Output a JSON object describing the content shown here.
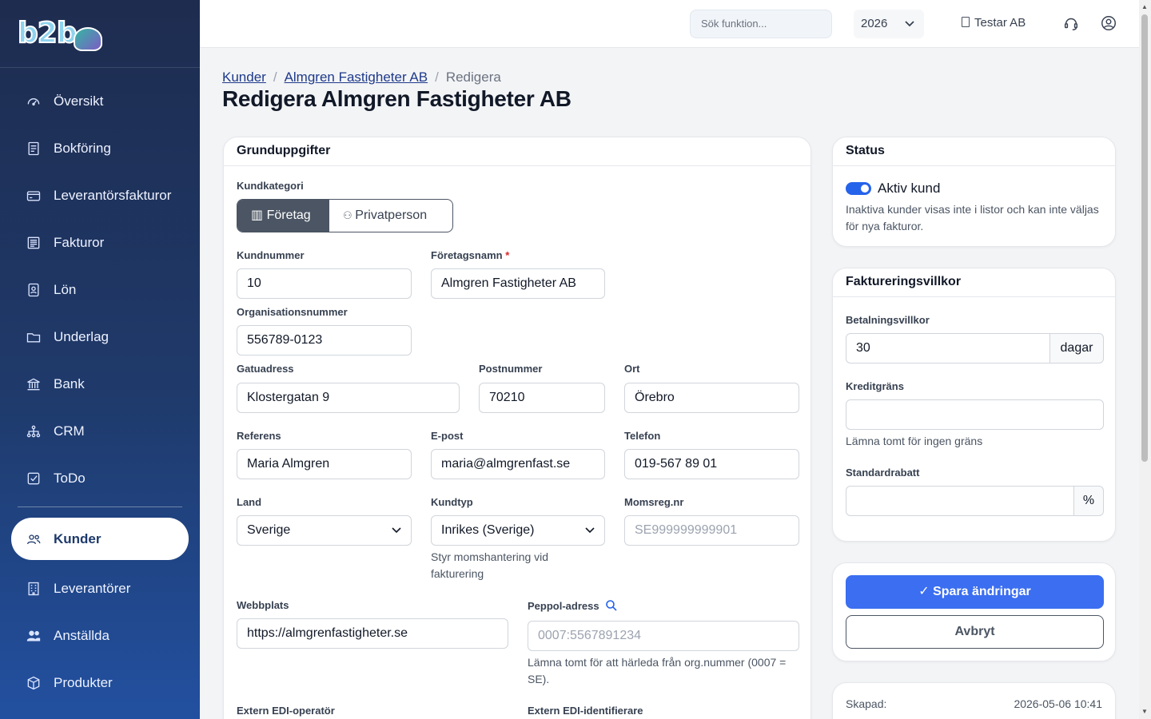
{
  "app": {
    "logo": "b2b"
  },
  "sidebar": {
    "items": [
      {
        "label": "Översikt",
        "icon": "gauge-icon"
      },
      {
        "label": "Bokföring",
        "icon": "ledger-icon"
      },
      {
        "label": "Leverantörsfakturor",
        "icon": "credit-card-icon"
      },
      {
        "label": "Fakturor",
        "icon": "invoice-icon"
      },
      {
        "label": "Lön",
        "icon": "badge-icon"
      },
      {
        "label": "Underlag",
        "icon": "folder-icon"
      },
      {
        "label": "Bank",
        "icon": "bank-icon"
      },
      {
        "label": "CRM",
        "icon": "org-chart-icon"
      },
      {
        "label": "ToDo",
        "icon": "checkbox-icon"
      },
      {
        "label": "Kunder",
        "icon": "users-icon",
        "active": true
      },
      {
        "label": "Leverantörer",
        "icon": "building-icon"
      },
      {
        "label": "Anställda",
        "icon": "people-icon"
      },
      {
        "label": "Produkter",
        "icon": "box-icon"
      }
    ]
  },
  "topbar": {
    "search_placeholder": "Sök funktion...",
    "year": "2026",
    "company": "Testar AB"
  },
  "breadcrumb": {
    "root": "Kunder",
    "customer": "Almgren Fastigheter AB",
    "current": "Redigera"
  },
  "page_title": "Redigera Almgren Fastigheter AB",
  "basics": {
    "title": "Grunduppgifter",
    "category_label": "Kundkategori",
    "category_company": "Företag",
    "category_private": "Privatperson",
    "customer_number_label": "Kundnummer",
    "customer_number": "10",
    "company_name_label": "Företagsnamn",
    "company_name": "Almgren Fastigheter AB",
    "org_number_label": "Organisationsnummer",
    "org_number": "556789-0123",
    "street_label": "Gatuadress",
    "street": "Klostergatan 9",
    "postal_label": "Postnummer",
    "postal": "70210",
    "city_label": "Ort",
    "city": "Örebro",
    "reference_label": "Referens",
    "reference": "Maria Almgren",
    "email_label": "E-post",
    "email": "maria@almgrenfast.se",
    "phone_label": "Telefon",
    "phone": "019-567 89 01",
    "country_label": "Land",
    "country": "Sverige",
    "customer_type_label": "Kundtyp",
    "customer_type": "Inrikes (Sverige)",
    "customer_type_hint": "Styr momshantering vid fakturering",
    "vat_label": "Momsreg.nr",
    "vat_placeholder": "SE999999999901",
    "website_label": "Webbplats",
    "website": "https://almgrenfastigheter.se",
    "peppol_label": "Peppol-adress",
    "peppol_placeholder": "0007:5567891234",
    "peppol_hint": "Lämna tomt för att härleda från org.nummer (0007 = SE).",
    "edi_operator_label": "Extern EDI-operatör",
    "edi_id_label": "Extern EDI-identifierare"
  },
  "status": {
    "title": "Status",
    "active_label": "Aktiv kund",
    "active": true,
    "hint": "Inaktiva kunder visas inte i listor och kan inte väljas för nya fakturor."
  },
  "billing": {
    "title": "Faktureringsvillkor",
    "payment_terms_label": "Betalningsvillkor",
    "payment_terms": "30",
    "payment_terms_unit": "dagar",
    "credit_limit_label": "Kreditgräns",
    "credit_limit_hint": "Lämna tomt för ingen gräns",
    "discount_label": "Standardrabatt",
    "discount_unit": "%"
  },
  "actions": {
    "save": "✓ Spara ändringar",
    "cancel": "Avbryt"
  },
  "meta": {
    "created_label": "Skapad:",
    "created": "2026-05-06 10:41"
  },
  "colors": {
    "primary": "#3b6ef0",
    "sidebar": "#1e2c4f",
    "active_text": "#1e3a6b"
  }
}
